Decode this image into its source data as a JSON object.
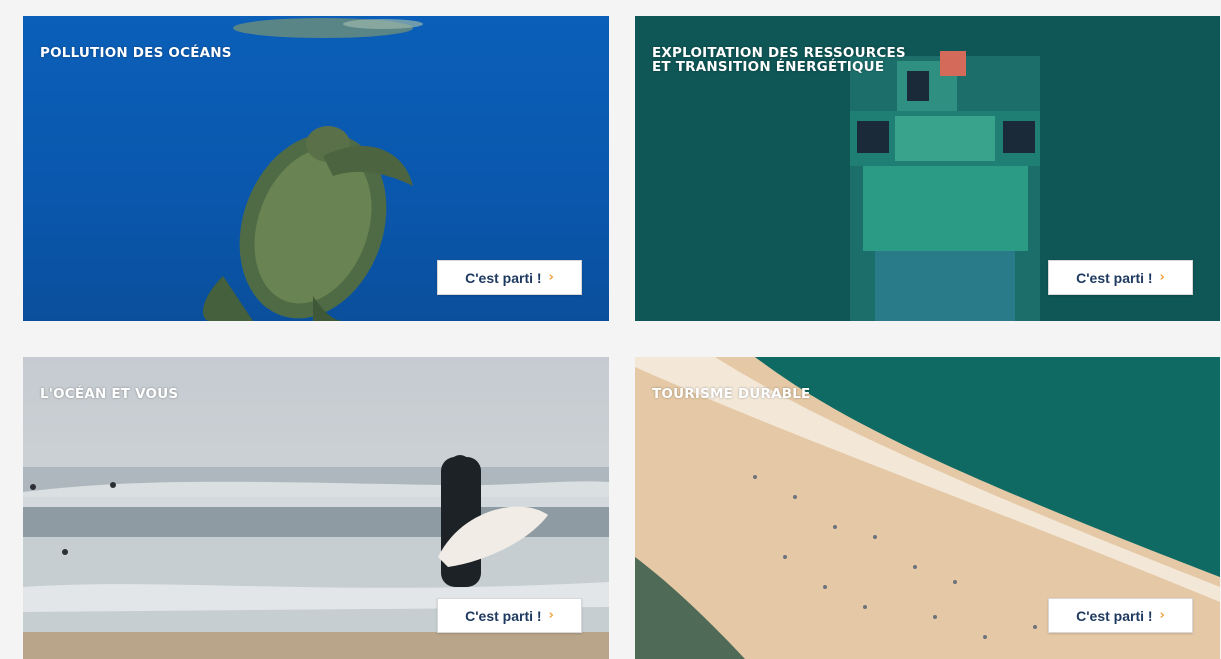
{
  "cards": [
    {
      "title": "POLLUTION DES OCÉANS",
      "cta": "C'est parti !",
      "chevron": "›"
    },
    {
      "title": "EXPLOITATION DES RESSOURCES\nET TRANSITION ÉNERGÉTIQUE",
      "cta": "C'est parti !",
      "chevron": "›"
    },
    {
      "title": "L'OCÉAN ET VOUS",
      "cta": "C'est parti !",
      "chevron": "›"
    },
    {
      "title": "TOURISME DURABLE",
      "cta": "C'est parti !",
      "chevron": "›"
    }
  ],
  "colors": {
    "page_background": "#f4f4f4",
    "button_text": "#1f3a60",
    "chevron_accent": "#f0a23a"
  }
}
